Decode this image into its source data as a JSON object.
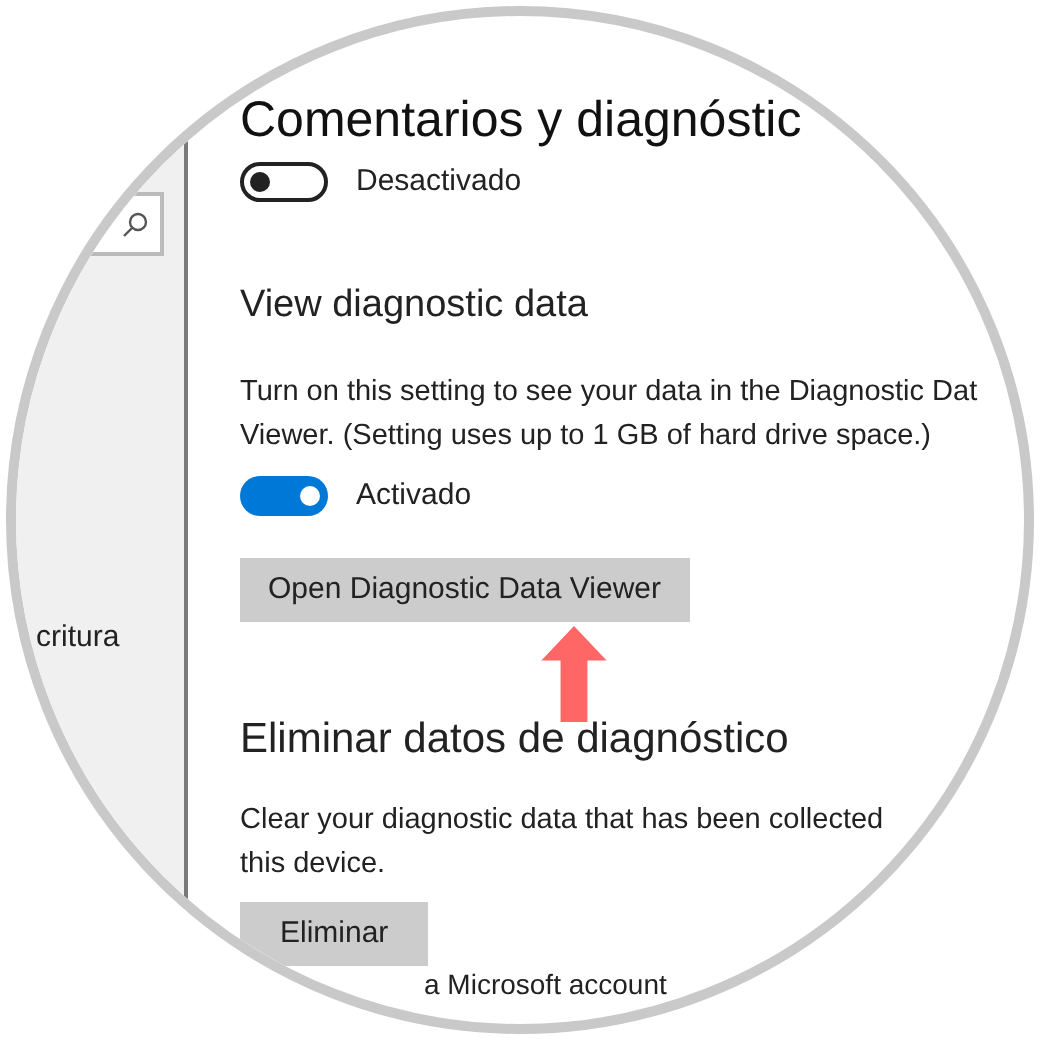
{
  "page_title": "Comentarios y diagnóstic",
  "sidebar": {
    "search": {
      "kind": "search"
    },
    "items": [
      {
        "label": "critura"
      }
    ]
  },
  "top_toggle": {
    "on": false,
    "label": "Desactivado"
  },
  "sections": [
    {
      "heading": "View diagnostic data",
      "lines": [
        "Turn on this setting to see your data in the Diagnostic Dat",
        "Viewer. (Setting uses up to 1 GB of hard drive space.)"
      ],
      "toggle": {
        "on": true,
        "label": "Activado"
      },
      "button": "Open Diagnostic Data Viewer",
      "annotation": {
        "kind": "up-arrow"
      }
    },
    {
      "heading": "Eliminar datos de diagnóstico",
      "lines": [
        "Clear your diagnostic data that has been collected",
        "this device."
      ],
      "button": "Eliminar"
    }
  ],
  "footer_text": "a Microsoft account"
}
